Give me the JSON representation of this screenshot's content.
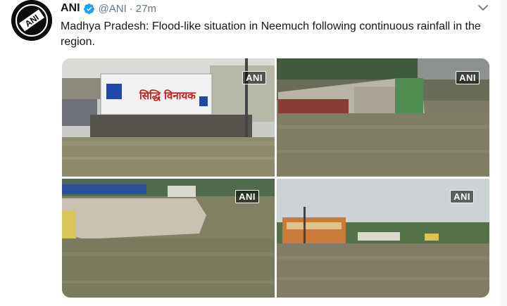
{
  "tweet": {
    "author_name": "ANI",
    "handle": "@ANI",
    "separator": "·",
    "time": "27m",
    "text": "Madhya Pradesh: Flood-like situation in Neemuch following continuous rainfall in the region.",
    "avatar_text": "ANI"
  },
  "media": {
    "photos": [
      {
        "watermark": "ANI",
        "sign_text": "सिद्धि विनायक"
      },
      {
        "watermark": "ANI"
      },
      {
        "watermark": "ANI"
      },
      {
        "watermark": "ANI"
      }
    ]
  },
  "icons": {
    "verified": "verified-badge-icon",
    "menu": "chevron-down-icon"
  },
  "colors": {
    "verified_blue": "#1da1f2",
    "secondary_text": "#657786",
    "primary_text": "#14171a"
  }
}
